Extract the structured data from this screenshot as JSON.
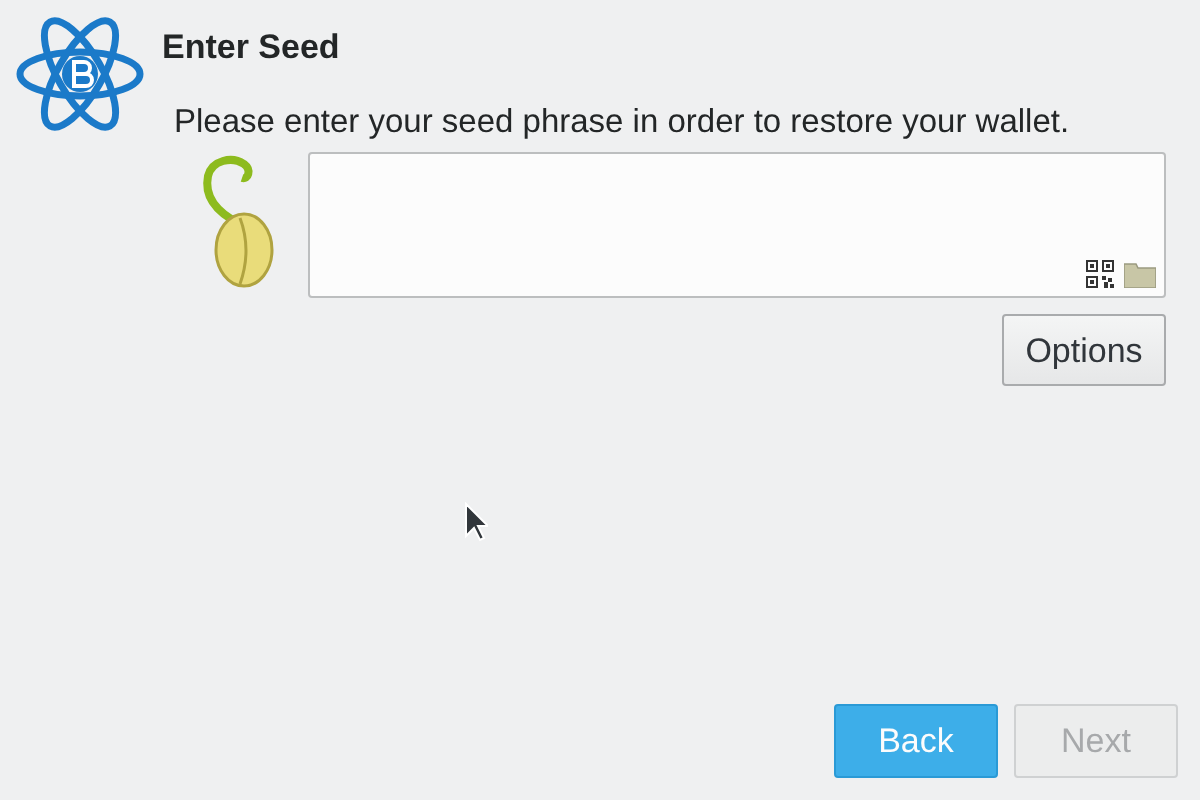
{
  "title": "Enter Seed",
  "message": "Please enter your seed phrase in order to restore your wallet.",
  "options_button": {
    "label": "Options"
  },
  "nav_buttons": [
    {
      "label": "Back",
      "kind": "primary",
      "disabled": false
    },
    {
      "label": "Next",
      "kind": "secondary",
      "disabled": true
    }
  ]
}
